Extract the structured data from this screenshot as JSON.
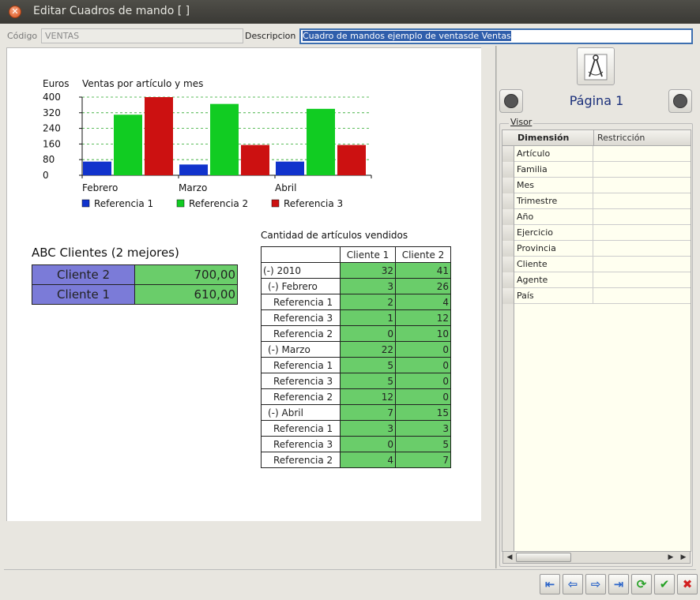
{
  "window": {
    "title": "Editar Cuadros de mando [  ]"
  },
  "form": {
    "codigo_label": "Código",
    "codigo_value": "VENTAS",
    "descripcion_label": "Descripcion",
    "descripcion_value": "Cuadro de mandos ejemplo de ventasde Ventas"
  },
  "chart_data": {
    "type": "bar",
    "title": "Ventas por artículo y mes",
    "ylabel": "Euros",
    "xlabel": "",
    "ylim": [
      0,
      400
    ],
    "yticks": [
      "0",
      "80",
      "160",
      "240",
      "320",
      "400"
    ],
    "categories": [
      "Febrero",
      "Marzo",
      "Abril"
    ],
    "series": [
      {
        "name": "Referencia 1",
        "color": "#1133cc",
        "values": [
          70,
          55,
          70
        ]
      },
      {
        "name": "Referencia 2",
        "color": "#11cc22",
        "values": [
          310,
          365,
          340
        ]
      },
      {
        "name": "Referencia 3",
        "color": "#cc1111",
        "values": [
          400,
          155,
          155
        ]
      }
    ],
    "grid": true,
    "legend": "bottom"
  },
  "abc": {
    "title": "ABC Clientes (2 mejores)",
    "rows": [
      {
        "name": "Cliente 2",
        "value": "700,00"
      },
      {
        "name": "Cliente 1",
        "value": "610,00"
      }
    ]
  },
  "cantidad": {
    "title": "Cantidad de artículos vendidos",
    "headers": [
      "",
      "Cliente 1",
      "Cliente 2"
    ],
    "rows": [
      {
        "label": "(-) 2010",
        "c1": "32",
        "c2": "41"
      },
      {
        "label": "(-) Febrero",
        "c1": "3",
        "c2": "26"
      },
      {
        "label": "Referencia 1",
        "c1": "2",
        "c2": "4"
      },
      {
        "label": "Referencia 3",
        "c1": "1",
        "c2": "12"
      },
      {
        "label": "Referencia 2",
        "c1": "0",
        "c2": "10"
      },
      {
        "label": "(-) Marzo",
        "c1": "22",
        "c2": "0"
      },
      {
        "label": "Referencia 1",
        "c1": "5",
        "c2": "0"
      },
      {
        "label": "Referencia 3",
        "c1": "5",
        "c2": "0"
      },
      {
        "label": "Referencia 2",
        "c1": "12",
        "c2": "0"
      },
      {
        "label": "(-) Abril",
        "c1": "7",
        "c2": "15"
      },
      {
        "label": "Referencia 1",
        "c1": "3",
        "c2": "3"
      },
      {
        "label": "Referencia 3",
        "c1": "0",
        "c2": "5"
      },
      {
        "label": "Referencia 2",
        "c1": "4",
        "c2": "7"
      }
    ]
  },
  "right": {
    "page_label": "Página 1",
    "visor_label": "Visor",
    "grid_headers": [
      "Dimensión",
      "Restricción"
    ],
    "dimensions": [
      "Artículo",
      "Familia",
      "Mes",
      "Trimestre",
      "Año",
      "Ejercicio",
      "Provincia",
      "Cliente",
      "Agente",
      "País"
    ]
  },
  "toolbar": {
    "buttons": [
      "first-icon",
      "previous-icon",
      "next-icon",
      "last-icon",
      "refresh-icon",
      "accept-icon",
      "cancel-icon"
    ]
  }
}
